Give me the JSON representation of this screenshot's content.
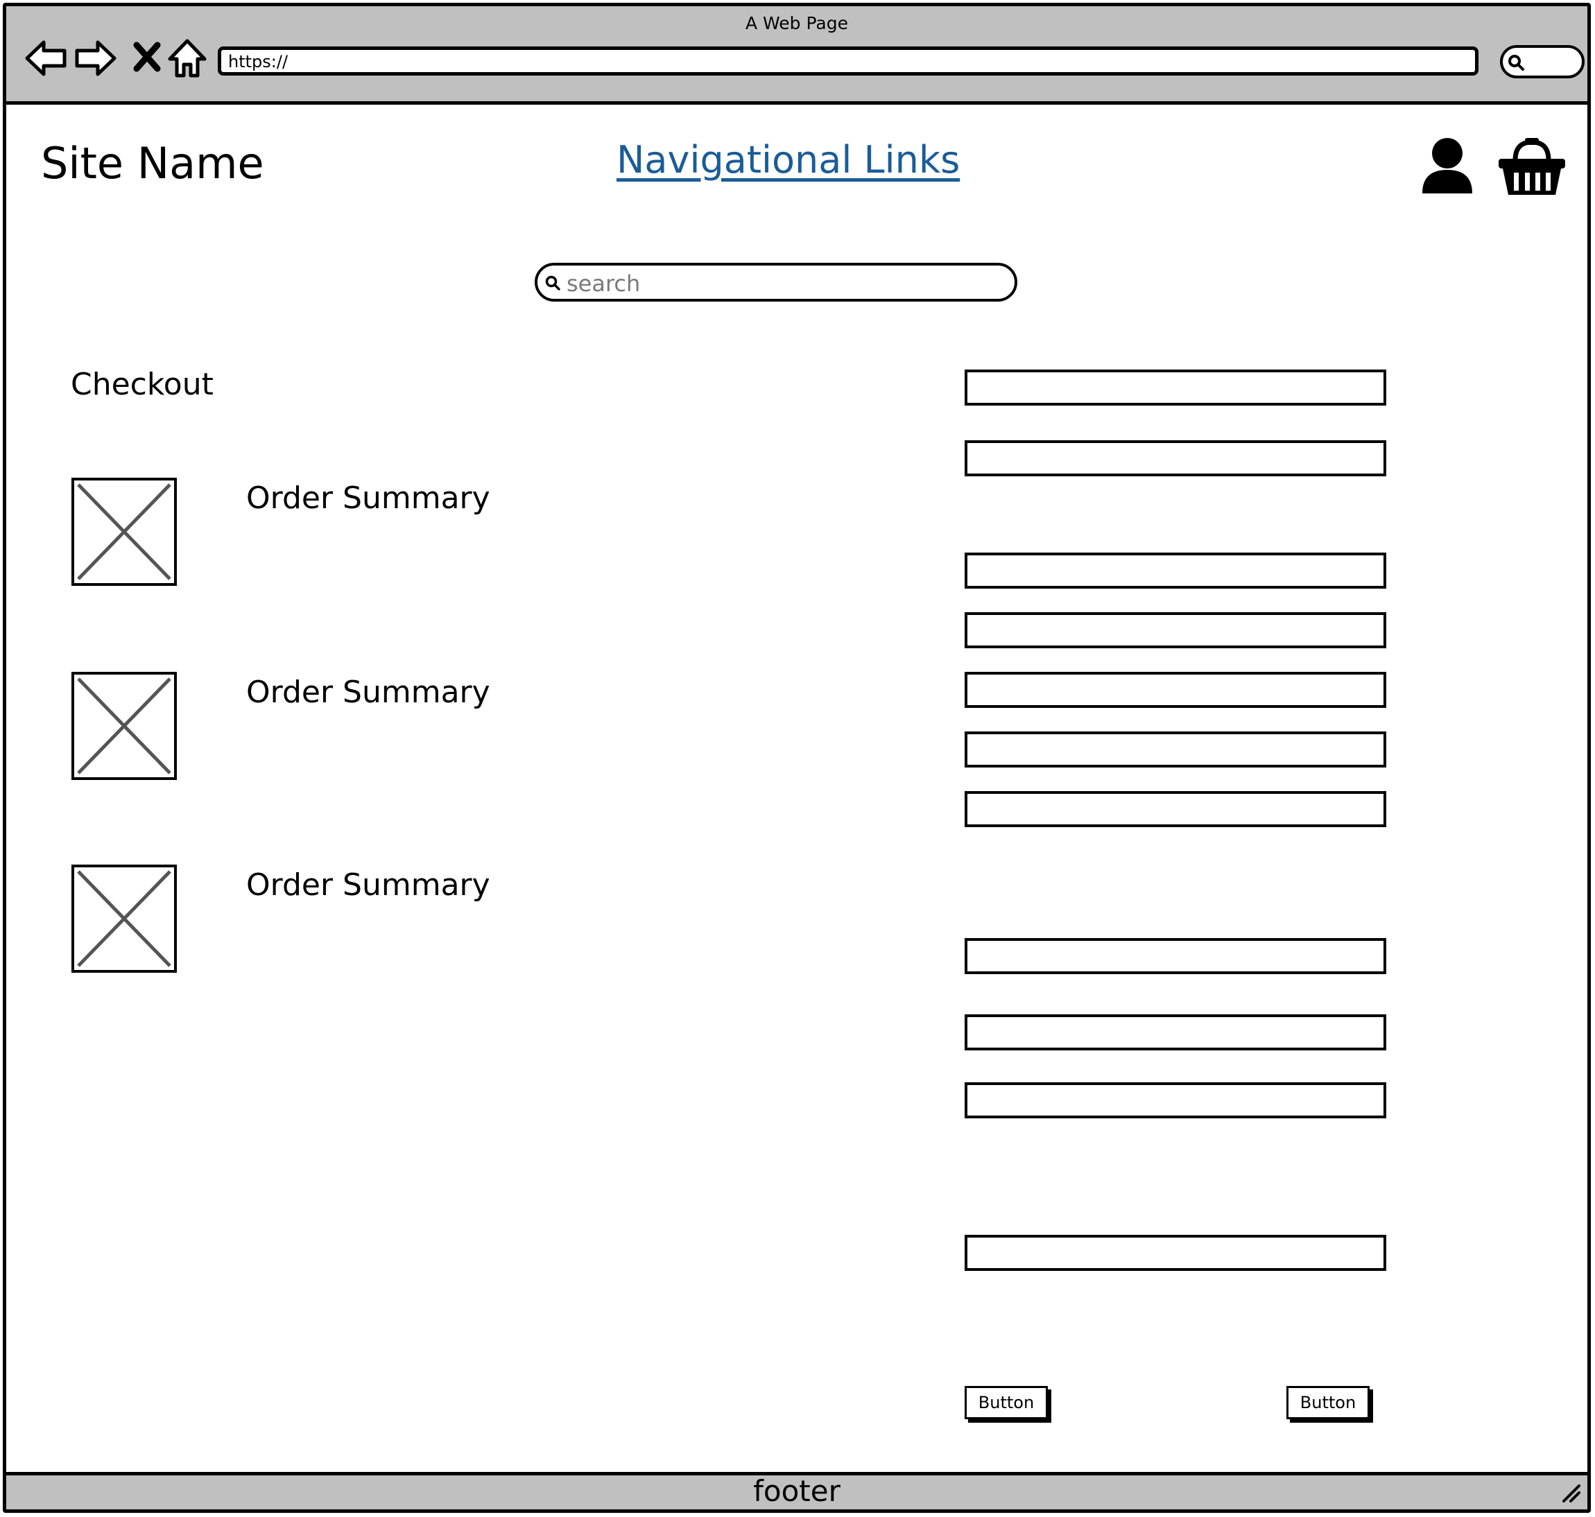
{
  "window": {
    "title": "A Web Page"
  },
  "browser": {
    "address": "https://",
    "buttons": [
      "back-arrow-icon",
      "forward-arrow-icon",
      "stop-icon",
      "home-icon"
    ],
    "search_icon": "search-icon"
  },
  "header": {
    "site_name": "Site Name",
    "nav_link": "Navigational Links",
    "icons": [
      "user-icon",
      "basket-icon"
    ]
  },
  "search": {
    "placeholder": "search"
  },
  "main": {
    "heading": "Checkout",
    "orders": [
      {
        "label": "Order Summary"
      },
      {
        "label": "Order Summary"
      },
      {
        "label": "Order Summary"
      }
    ]
  },
  "form": {
    "field_count": 11,
    "buttons": [
      "Button",
      "Button"
    ]
  },
  "footer": {
    "text": "footer"
  },
  "colors": {
    "chrome": "#c0c0c0",
    "link": "#1a5c98",
    "placeholder_frame": "#555555"
  }
}
